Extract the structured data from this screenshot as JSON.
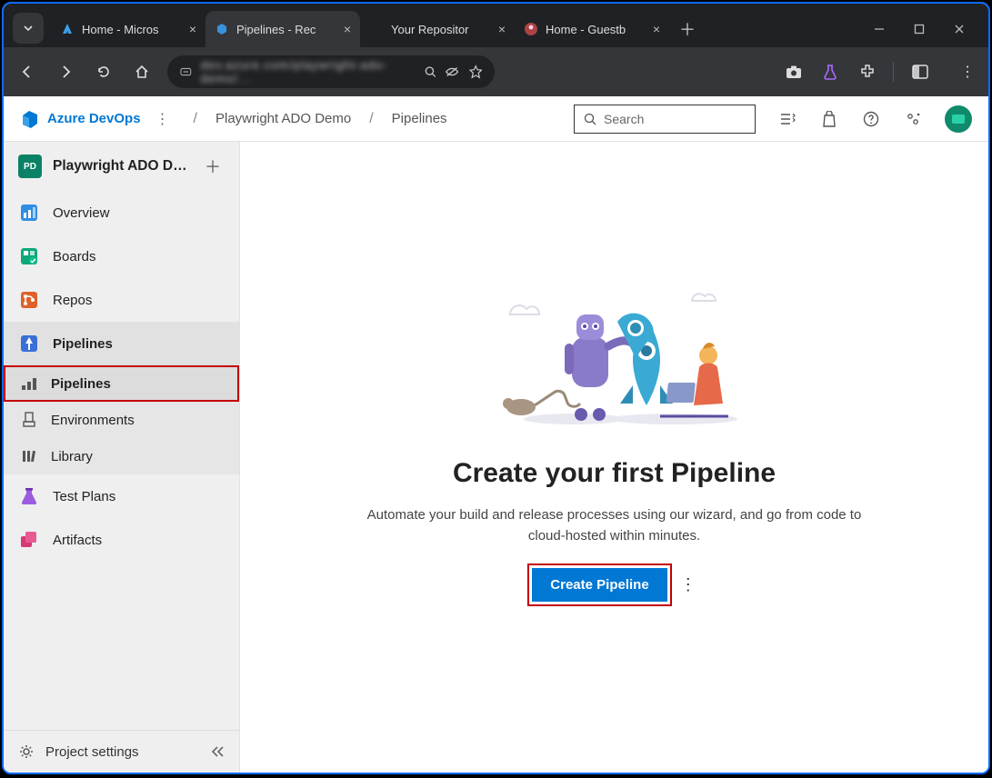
{
  "browser": {
    "tabs": [
      {
        "title": "Home - Micros",
        "active": false
      },
      {
        "title": "Pipelines - Rec",
        "active": true
      },
      {
        "title": "Your Repositor",
        "active": false
      },
      {
        "title": "Home - Guestb",
        "active": false
      }
    ],
    "url_obscured": "dev.azure.com/playwright-ado-demo/..."
  },
  "header": {
    "product": "Azure DevOps",
    "breadcrumbs": [
      "Playwright ADO Demo",
      "Pipelines"
    ],
    "search_placeholder": "Search"
  },
  "sidebar": {
    "project": {
      "badge": "PD",
      "name": "Playwright ADO De..."
    },
    "items": [
      {
        "label": "Overview"
      },
      {
        "label": "Boards"
      },
      {
        "label": "Repos"
      },
      {
        "label": "Pipelines",
        "active": true,
        "children": [
          {
            "label": "Pipelines",
            "highlighted": true
          },
          {
            "label": "Environments"
          },
          {
            "label": "Library"
          }
        ]
      },
      {
        "label": "Test Plans"
      },
      {
        "label": "Artifacts"
      }
    ],
    "footer": "Project settings"
  },
  "main": {
    "title": "Create your first Pipeline",
    "subtitle": "Automate your build and release processes using our wizard, and go from code to cloud-hosted within minutes.",
    "button": "Create Pipeline"
  }
}
